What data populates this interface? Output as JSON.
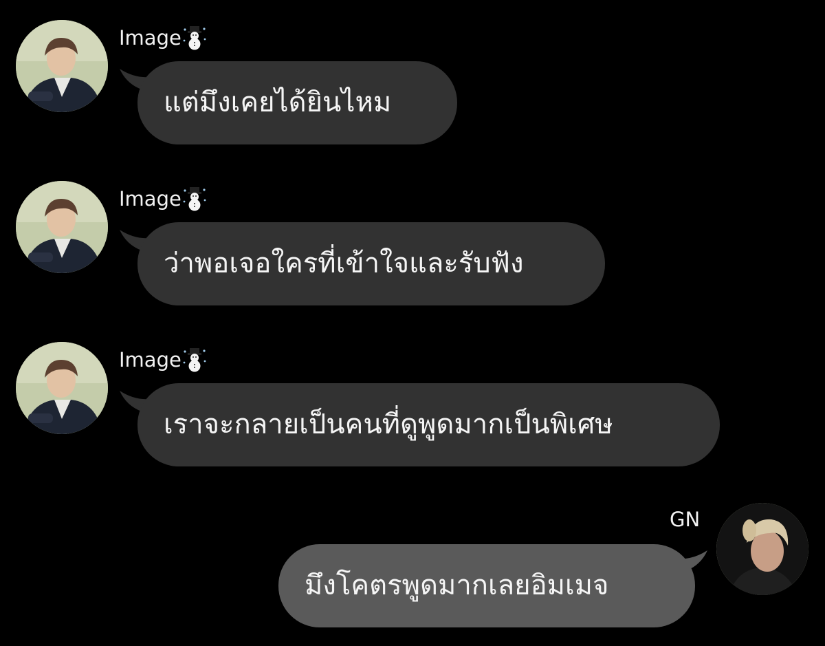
{
  "messages": [
    {
      "sender": "Image",
      "sender_icon": "snowman-emoji",
      "text": "แต่มึงเคยได้ยินไหม",
      "direction": "incoming"
    },
    {
      "sender": "Image",
      "sender_icon": "snowman-emoji",
      "text": "ว่าพอเจอใครที่เข้าใจและรับฟัง",
      "direction": "incoming"
    },
    {
      "sender": "Image",
      "sender_icon": "snowman-emoji",
      "text": "เราจะกลายเป็นคนที่ดูพูดมากเป็นพิเศษ",
      "direction": "incoming"
    },
    {
      "sender": "GN",
      "text": "มึงโคตรพูดมากเลยอิมเมจ",
      "direction": "outgoing"
    }
  ],
  "colors": {
    "background": "#000000",
    "incoming_bubble": "#323232",
    "outgoing_bubble": "#5a5a5a",
    "text": "#f5f5f5"
  }
}
